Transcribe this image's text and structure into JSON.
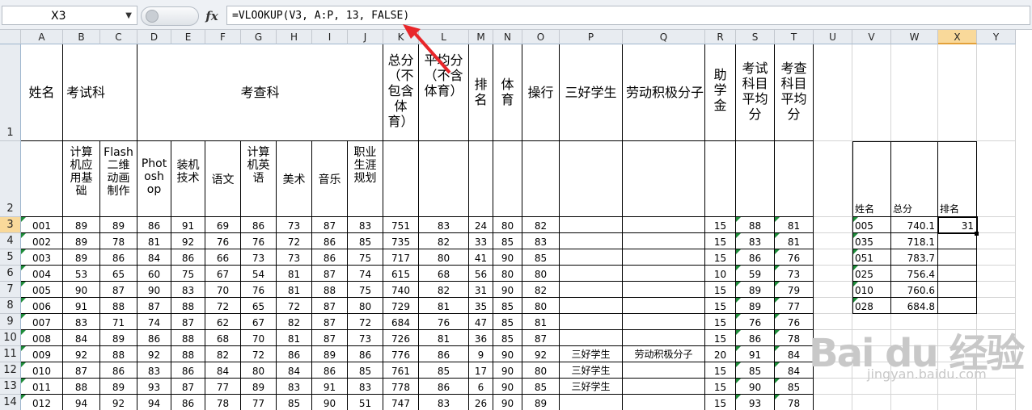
{
  "formula_bar": {
    "name_box": "X3",
    "dropdown": "▼",
    "fx_label": "fx",
    "formula": "=VLOOKUP(V3, A:P, 13, FALSE)"
  },
  "columns": [
    "A",
    "B",
    "C",
    "D",
    "E",
    "F",
    "G",
    "H",
    "I",
    "J",
    "K",
    "L",
    "M",
    "N",
    "O",
    "P",
    "Q",
    "R",
    "S",
    "T",
    "U",
    "V",
    "W",
    "X",
    "Y"
  ],
  "header_row1": {
    "A": "姓名",
    "B": "考试科",
    "E": "考查科",
    "K": "总分（不包含体育）",
    "L": "平均分（不含体育）",
    "M": "排名",
    "N": "体育",
    "O": "操行",
    "P": "三好学生",
    "Q": "劳动积极分子",
    "R": "助学金",
    "S": "考试科目平均分",
    "T": "考查科目平均分"
  },
  "header_row2": {
    "B": "计算机应用基础",
    "C": "Flash二维动画制作",
    "D": "Photoshop",
    "E": "装机技术",
    "F": "语文",
    "G": "计算机英语",
    "H": "美术",
    "I": "音乐",
    "J": "职业生涯规划",
    "V": "姓名",
    "W": "总分",
    "X": "排名"
  },
  "rows": [
    {
      "r": "3",
      "cells": [
        "001",
        "89",
        "89",
        "86",
        "91",
        "69",
        "86",
        "73",
        "87",
        "83",
        "751",
        "83",
        "24",
        "80",
        "82",
        "",
        "",
        "15",
        "88",
        "81"
      ]
    },
    {
      "r": "4",
      "cells": [
        "002",
        "89",
        "78",
        "81",
        "92",
        "76",
        "76",
        "72",
        "86",
        "85",
        "735",
        "82",
        "33",
        "85",
        "83",
        "",
        "",
        "15",
        "83",
        "81"
      ]
    },
    {
      "r": "5",
      "cells": [
        "003",
        "89",
        "86",
        "84",
        "86",
        "66",
        "73",
        "73",
        "86",
        "75",
        "717",
        "80",
        "41",
        "90",
        "85",
        "",
        "",
        "15",
        "86",
        "76"
      ]
    },
    {
      "r": "6",
      "cells": [
        "004",
        "53",
        "65",
        "60",
        "75",
        "67",
        "54",
        "81",
        "87",
        "74",
        "615",
        "68",
        "56",
        "80",
        "80",
        "",
        "",
        "10",
        "59",
        "73"
      ]
    },
    {
      "r": "7",
      "cells": [
        "005",
        "90",
        "87",
        "90",
        "83",
        "70",
        "76",
        "81",
        "88",
        "75",
        "740",
        "82",
        "31",
        "90",
        "82",
        "",
        "",
        "15",
        "89",
        "79"
      ]
    },
    {
      "r": "8",
      "cells": [
        "006",
        "91",
        "88",
        "87",
        "88",
        "72",
        "65",
        "72",
        "87",
        "80",
        "729",
        "81",
        "35",
        "85",
        "80",
        "",
        "",
        "15",
        "89",
        "77"
      ]
    },
    {
      "r": "9",
      "cells": [
        "007",
        "83",
        "71",
        "74",
        "87",
        "62",
        "67",
        "82",
        "87",
        "72",
        "684",
        "76",
        "47",
        "85",
        "81",
        "",
        "",
        "15",
        "76",
        "76"
      ]
    },
    {
      "r": "10",
      "cells": [
        "008",
        "84",
        "89",
        "86",
        "88",
        "68",
        "70",
        "81",
        "87",
        "73",
        "726",
        "81",
        "36",
        "85",
        "87",
        "",
        "",
        "15",
        "86",
        "78"
      ]
    },
    {
      "r": "11",
      "cells": [
        "009",
        "92",
        "88",
        "92",
        "88",
        "82",
        "72",
        "86",
        "89",
        "86",
        "776",
        "86",
        "9",
        "90",
        "92",
        "三好学生",
        "劳动积极分子",
        "20",
        "91",
        "84"
      ]
    },
    {
      "r": "12",
      "cells": [
        "010",
        "87",
        "86",
        "83",
        "86",
        "84",
        "80",
        "84",
        "86",
        "85",
        "761",
        "85",
        "17",
        "90",
        "80",
        "三好学生",
        "",
        "15",
        "85",
        "84"
      ]
    },
    {
      "r": "13",
      "cells": [
        "011",
        "88",
        "89",
        "93",
        "87",
        "77",
        "89",
        "83",
        "91",
        "83",
        "778",
        "86",
        "6",
        "90",
        "85",
        "三好学生",
        "",
        "15",
        "90",
        "85"
      ]
    },
    {
      "r": "14",
      "cells": [
        "012",
        "94",
        "92",
        "94",
        "86",
        "78",
        "77",
        "85",
        "90",
        "51",
        "747",
        "83",
        "26",
        "90",
        "89",
        "",
        "",
        "15",
        "93",
        "78"
      ]
    }
  ],
  "lookup_table": [
    {
      "name": "005",
      "total": "740.1",
      "rank": "31"
    },
    {
      "name": "035",
      "total": "718.1",
      "rank": ""
    },
    {
      "name": "051",
      "total": "783.7",
      "rank": ""
    },
    {
      "name": "025",
      "total": "756.4",
      "rank": ""
    },
    {
      "name": "010",
      "total": "760.6",
      "rank": ""
    },
    {
      "name": "028",
      "total": "684.8",
      "rank": ""
    }
  ],
  "watermark": {
    "logo": "Bai du 经验",
    "url": "jingyan.baidu.com"
  },
  "colors": {
    "accent_arrow": "#e8262a",
    "selection_header": "#f9d99a",
    "grid": "#d4d4d4",
    "border": "#000000"
  }
}
